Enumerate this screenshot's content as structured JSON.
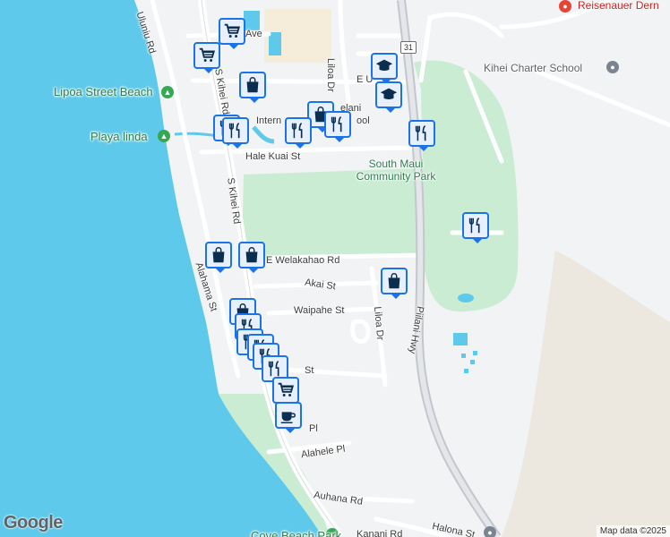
{
  "map": {
    "water_color": "#5ec9ea",
    "land_color": "#f1f3f4",
    "park_color": "#c9ecd3",
    "pin_color": "#1a73e8",
    "pin_fill": "#e8f0fe"
  },
  "labels": {
    "uluniu_rd": "Uluniu Rd",
    "ave": "Ave",
    "liloa_dr_north": "Liloa Dr",
    "e_u": "E U",
    "lipoa_beach": "Lipoa Street Beach",
    "kihei_rd_north": "S Kihei Rd",
    "playa_linda": "Playa linda",
    "kihei_charter": "Kihei Charter School",
    "reisenauer": "Reisenauer Dern",
    "intern": "Intern",
    "elani": "elani",
    "ool": "ool",
    "hale_kuai": "Hale Kuai St",
    "south_maui_park": "South Maui Community Park",
    "kihei_rd_mid": "S Kihei Rd",
    "welakahao": "E Welakahao Rd",
    "alahama": "Alahama St",
    "akai": "Akai St",
    "waipahe": "Waipahe St",
    "liloa_dr_south": "Liloa Dr",
    "piilani_hwy": "Piilani Hwy",
    "st_partial": "St",
    "pl_partial": "Pl",
    "alahele": "Alahele Pl",
    "auhana": "Auhana Rd",
    "kanani": "Kanani Rd",
    "halona": "Halona St",
    "cove_beach": "Cove Beach Park",
    "route_31": "31"
  },
  "pins": [
    {
      "type": "grocery",
      "icon": "grocery-cart-icon"
    },
    {
      "type": "grocery",
      "icon": "grocery-cart-icon"
    },
    {
      "type": "shopping",
      "icon": "shopping-bag-icon"
    },
    {
      "type": "school",
      "icon": "graduation-cap-icon"
    },
    {
      "type": "school",
      "icon": "graduation-cap-icon"
    },
    {
      "type": "restaurant",
      "icon": "fork-knife-icon"
    },
    {
      "type": "restaurant",
      "icon": "fork-knife-icon"
    },
    {
      "type": "shopping",
      "icon": "shopping-bag-icon"
    },
    {
      "type": "restaurant",
      "icon": "fork-knife-icon"
    },
    {
      "type": "restaurant",
      "icon": "fork-knife-icon"
    },
    {
      "type": "restaurant",
      "icon": "fork-knife-icon"
    },
    {
      "type": "restaurant",
      "icon": "fork-knife-icon"
    },
    {
      "type": "shopping",
      "icon": "shopping-bag-icon"
    },
    {
      "type": "shopping",
      "icon": "shopping-bag-icon"
    },
    {
      "type": "shopping",
      "icon": "shopping-bag-icon"
    },
    {
      "type": "shopping",
      "icon": "shopping-bag-icon"
    },
    {
      "type": "restaurant",
      "icon": "fork-knife-icon"
    },
    {
      "type": "restaurant",
      "icon": "fork-knife-icon"
    },
    {
      "type": "restaurant",
      "icon": "fork-knife-icon"
    },
    {
      "type": "restaurant",
      "icon": "fork-knife-icon"
    },
    {
      "type": "restaurant",
      "icon": "fork-knife-icon"
    },
    {
      "type": "grocery",
      "icon": "grocery-cart-icon"
    },
    {
      "type": "cafe",
      "icon": "coffee-cup-icon"
    }
  ],
  "footer": {
    "logo": "Google",
    "attribution": "Map data ©2025"
  }
}
